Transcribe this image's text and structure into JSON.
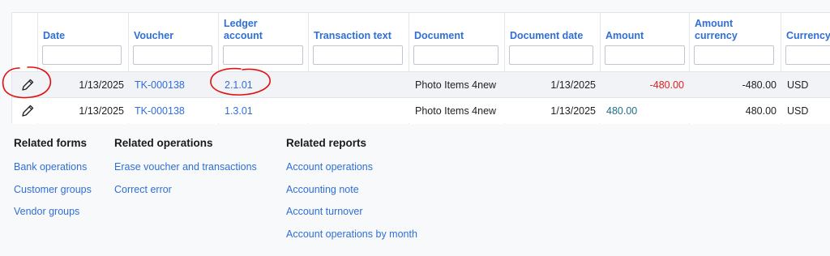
{
  "grid": {
    "headers": {
      "date": "Date",
      "voucher": "Voucher",
      "ledger_account_line1": "Ledger",
      "ledger_account_line2": "account",
      "transaction_text": "Transaction text",
      "document": "Document",
      "document_date": "Document date",
      "amount": "Amount",
      "amount_currency_line1": "Amount",
      "amount_currency_line2": "currency",
      "currency": "Currency"
    },
    "rows": [
      {
        "date": "1/13/2025",
        "voucher": "TK-000138",
        "ledger_account": "2.1.01",
        "transaction_text": "",
        "document": "Photo Items 4new",
        "document_date": "1/13/2025",
        "amount": "-480.00",
        "amount_currency": "-480.00",
        "currency": "USD"
      },
      {
        "date": "1/13/2025",
        "voucher": "TK-000138",
        "ledger_account": "1.3.01",
        "transaction_text": "",
        "document": "Photo Items 4new",
        "document_date": "1/13/2025",
        "amount": "480.00",
        "amount_currency": "480.00",
        "currency": "USD"
      }
    ]
  },
  "related_forms": {
    "title": "Related forms",
    "items": [
      "Bank operations",
      "Customer groups",
      "Vendor groups"
    ]
  },
  "related_operations": {
    "title": "Related operations",
    "items": [
      "Erase voucher and transactions",
      "Correct error"
    ]
  },
  "related_reports": {
    "title": "Related reports",
    "items": [
      "Account operations",
      "Accounting note",
      "Account turnover",
      "Account operations by month"
    ]
  },
  "colors": {
    "link": "#2f6fd6",
    "negative_amount": "#e02020",
    "positive_amount": "#1f6f8b",
    "annotation": "#e01010"
  },
  "icons": [
    "pencil-icon"
  ]
}
